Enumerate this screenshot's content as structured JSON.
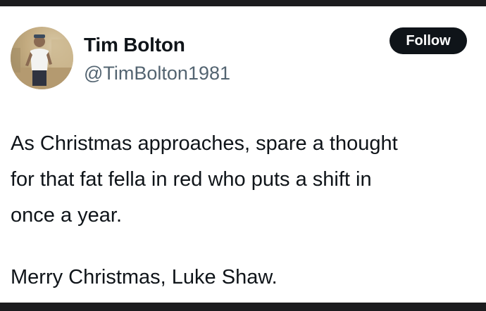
{
  "profile": {
    "display_name": "Tim Bolton",
    "handle": "@TimBolton1981",
    "avatar_icon": "user-photo-avatar"
  },
  "actions": {
    "follow_label": "Follow"
  },
  "tweet": {
    "lines": [
      "As Christmas approaches, spare a thought",
      "for that fat fella in red who puts a shift in",
      "once a year."
    ],
    "closing": "Merry Christmas, Luke Shaw."
  },
  "colors": {
    "primary_text": "#0f1419",
    "secondary_text": "#536471",
    "button_bg": "#0f1419",
    "frame": "#1c1c1e"
  }
}
